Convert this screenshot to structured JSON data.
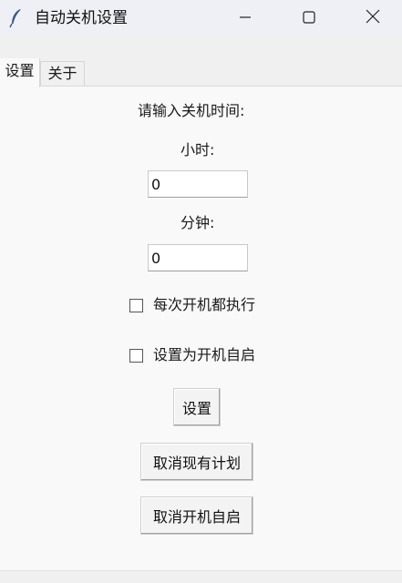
{
  "window": {
    "title": "自动关机设置",
    "icon": "feather-icon",
    "controls": [
      "minimize-icon",
      "maximize-icon",
      "close-icon"
    ]
  },
  "tabs": [
    {
      "label": "设置",
      "active": true
    },
    {
      "label": "关于",
      "active": false
    }
  ],
  "form": {
    "prompt": "请输入关机时间:",
    "hours_label": "小时:",
    "hours_value": "0",
    "minutes_label": "分钟:",
    "minutes_value": "0",
    "checkboxes": [
      {
        "label": "每次开机都执行",
        "checked": false
      },
      {
        "label": "设置为开机自启",
        "checked": false
      }
    ]
  },
  "buttons": {
    "set": "设置",
    "cancel_plan": "取消现有计划",
    "cancel_autostart": "取消开机自启"
  }
}
